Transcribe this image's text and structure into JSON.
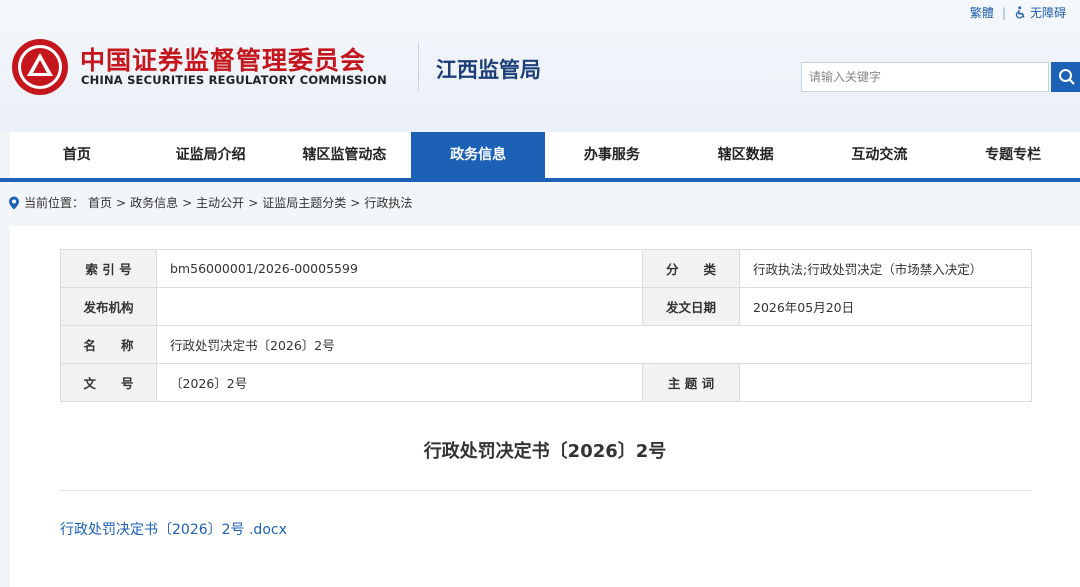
{
  "top_links": {
    "traditional": "繁體",
    "separator": "|",
    "accessibility": "无障碍"
  },
  "brand": {
    "name_cn": "中国证券监督管理委员会",
    "name_en": "CHINA SECURITIES REGULATORY COMMISSION",
    "bureau": "江西监管局"
  },
  "search": {
    "placeholder": "请输入关键字"
  },
  "nav": {
    "items": [
      {
        "label": "首页"
      },
      {
        "label": "证监局介绍"
      },
      {
        "label": "辖区监管动态"
      },
      {
        "label": "政务信息"
      },
      {
        "label": "办事服务"
      },
      {
        "label": "辖区数据"
      },
      {
        "label": "互动交流"
      },
      {
        "label": "专题专栏"
      }
    ],
    "active_index": 3
  },
  "breadcrumb": {
    "prefix": "当前位置：",
    "items": [
      "首页",
      "政务信息",
      "主动公开",
      "证监局主题分类",
      "行政执法"
    ],
    "separator": ">"
  },
  "meta": {
    "index_label": "索 引 号",
    "index_value": "bm56000001/2026-00005599",
    "category_label": "分　　类",
    "category_value": "行政执法;行政处罚决定（市场禁入决定）",
    "publisher_label": "发布机构",
    "publisher_value": "",
    "date_label": "发文日期",
    "date_value": "2026年05月20日",
    "name_label": "名　　称",
    "name_value": "行政处罚决定书〔2026〕2号",
    "docno_label": "文　　号",
    "docno_value": "〔2026〕2号",
    "subject_label": "主 题 词",
    "subject_value": ""
  },
  "document": {
    "title": "行政处罚决定书〔2026〕2号",
    "attachment": "行政处罚决定书〔2026〕2号 .docx"
  },
  "colors": {
    "primary": "#1c61b5",
    "brand_red": "#c4161c"
  },
  "icons": [
    "accessibility-icon",
    "search-icon",
    "location-pin-icon",
    "csrc-emblem-icon"
  ]
}
